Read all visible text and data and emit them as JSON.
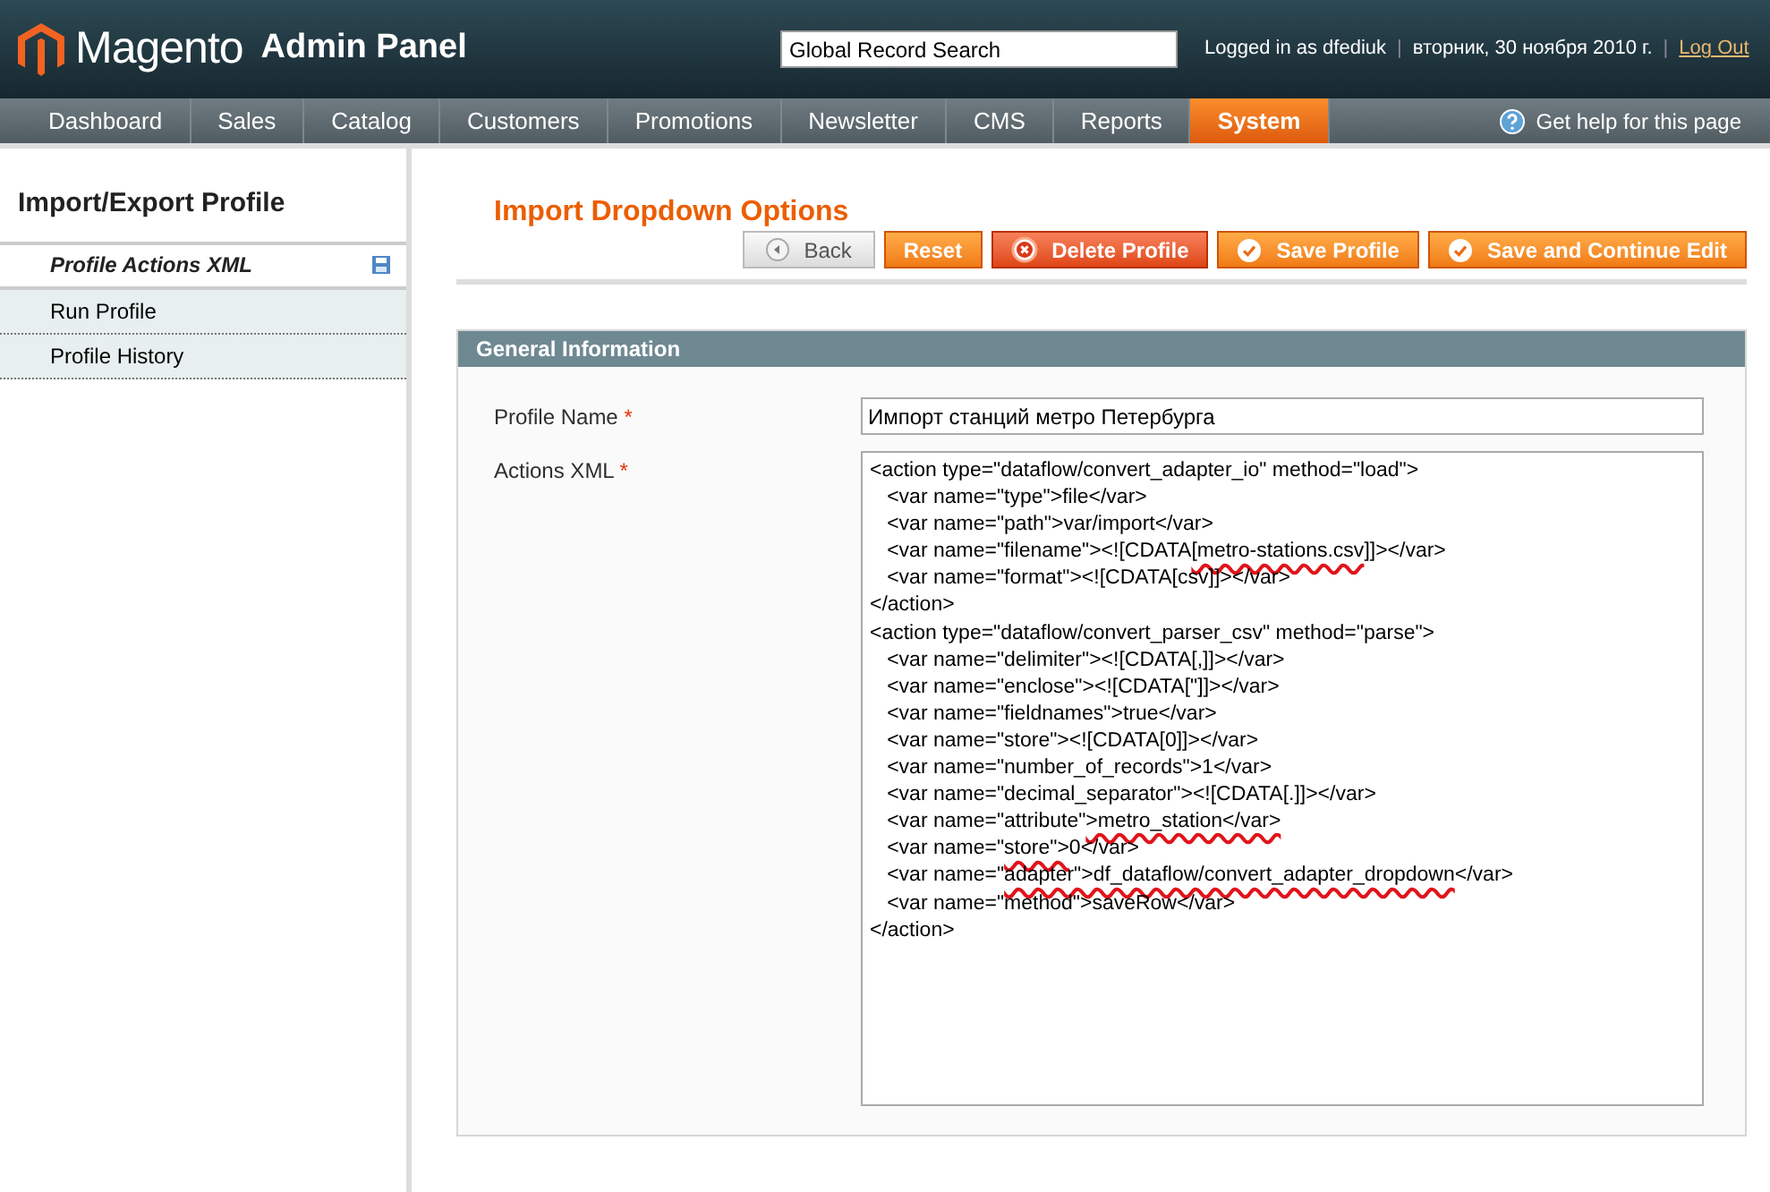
{
  "header": {
    "logo": "Magento",
    "logo_suffix": "Admin Panel",
    "search": {
      "value": "Global Record Search"
    },
    "user_text": "Logged in as dfediuk",
    "date": "вторник, 30 ноября 2010 г.",
    "logout": "Log Out",
    "separator": "|"
  },
  "nav": {
    "items": [
      {
        "label": "Dashboard",
        "selected": false
      },
      {
        "label": "Sales",
        "selected": false
      },
      {
        "label": "Catalog",
        "selected": false
      },
      {
        "label": "Customers",
        "selected": false
      },
      {
        "label": "Promotions",
        "selected": false
      },
      {
        "label": "Newsletter",
        "selected": false
      },
      {
        "label": "CMS",
        "selected": false
      },
      {
        "label": "Reports",
        "selected": false
      },
      {
        "label": "System",
        "selected": true
      }
    ],
    "help": "Get help for this page"
  },
  "sidebar": {
    "title": "Import/Export Profile",
    "items": [
      {
        "label": "Profile Actions XML",
        "selected": true
      },
      {
        "label": "Run Profile",
        "selected": false
      },
      {
        "label": "Profile History",
        "selected": false
      }
    ]
  },
  "page_title": "Import Dropdown Options",
  "buttons": [
    {
      "label": "Back",
      "kind": "back"
    },
    {
      "label": "Reset",
      "kind": "plain"
    },
    {
      "label": "Delete Profile",
      "kind": "delete"
    },
    {
      "label": "Save Profile",
      "kind": "save"
    },
    {
      "label": "Save and Continue Edit",
      "kind": "save"
    }
  ],
  "section": {
    "title": "General Information",
    "fields": [
      {
        "label": "Profile Name",
        "required": "*",
        "kind": "input",
        "value": "Импорт станций метро Петербурга"
      },
      {
        "label": "Actions XML",
        "required": "*",
        "kind": "code",
        "lines": [
          [
            {
              "text": "<action type=\"dataflow/convert_adapter_io\" method=\"load\">",
              "underlined": false
            }
          ],
          [
            {
              "text": "   <var name=\"type\">file</var>",
              "underlined": false
            }
          ],
          [
            {
              "text": "   <var name=\"path\">var/import</var>",
              "underlined": false
            }
          ],
          [
            {
              "text": "   <var name=\"filename\"><![CDATA",
              "underlined": false
            },
            {
              "text": "[metro-stations.csv",
              "underlined": true
            },
            {
              "text": "]]></var>",
              "underlined": false
            }
          ],
          [
            {
              "text": "   <var name=\"format\"><![CDATA[csv]]></var>",
              "underlined": false
            }
          ],
          [
            {
              "text": "</action>",
              "underlined": false
            }
          ],
          [
            {
              "text": "<action type=\"dataflow/convert_parser_csv\" method=\"parse\">",
              "underlined": false
            }
          ],
          [
            {
              "text": "   <var name=\"delimiter\"><![CDATA[,]]></var>",
              "underlined": false
            }
          ],
          [
            {
              "text": "   <var name=\"enclose\"><![CDATA[\"]]></var>",
              "underlined": false
            }
          ],
          [
            {
              "text": "   <var name=\"fieldnames\">true</var>",
              "underlined": false
            }
          ],
          [
            {
              "text": "   <var name=\"store\"><![CDATA[0]]></var>",
              "underlined": false
            }
          ],
          [
            {
              "text": "   <var name=\"number_of_records\">1</var>",
              "underlined": false
            }
          ],
          [
            {
              "text": "   <var name=\"decimal_separator\"><![CDATA[.]]></var>",
              "underlined": false
            }
          ],
          [
            {
              "text": "   <var name=\"attribute\"",
              "underlined": false
            },
            {
              "text": ">metro_station</var>",
              "underlined": true
            }
          ],
          [
            {
              "text": "   <var name=\"",
              "underlined": false
            },
            {
              "text": "store\">",
              "underlined": true
            },
            {
              "text": "0</var>",
              "underlined": false
            }
          ],
          [
            {
              "text": "   <var name=\"",
              "underlined": false
            },
            {
              "text": "adapter\">df_dataflow/convert_adapter_dropdown",
              "underlined": true
            },
            {
              "text": "</var>",
              "underlined": false
            }
          ],
          [
            {
              "text": "   <var name=\"method\">saveRow</var>",
              "underlined": false
            }
          ],
          [
            {
              "text": "</action>",
              "underlined": false
            }
          ]
        ]
      }
    ]
  }
}
